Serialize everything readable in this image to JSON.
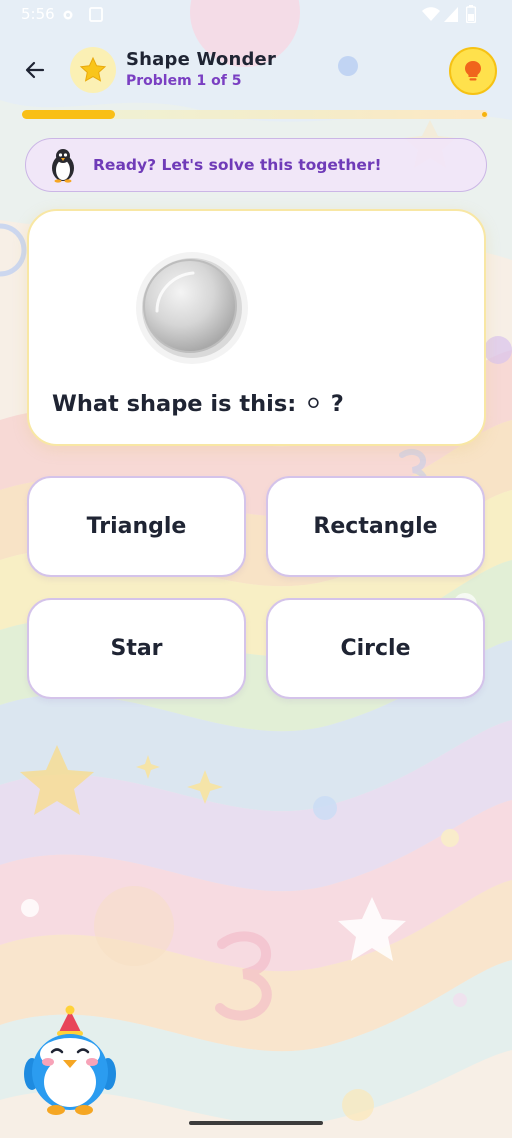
{
  "status_bar": {
    "time": "5:56",
    "icons": [
      "settings-gear-icon",
      "clipboard-icon",
      "wifi-icon",
      "signal-icon",
      "battery-icon"
    ]
  },
  "header": {
    "back_icon": "arrow-left-icon",
    "badge_icon": "star-icon",
    "title": "Shape Wonder",
    "subtitle": "Problem 1 of 5",
    "hint_icon": "lightbulb-icon"
  },
  "progress": {
    "current": 1,
    "total": 5,
    "fraction": 0.2
  },
  "message": {
    "icon": "penguin-icon",
    "text": "Ready? Let's solve this together!"
  },
  "question": {
    "image_icon": "gray-circle-icon",
    "text": "What shape is this: ⚪ ?"
  },
  "answers": [
    {
      "label": "Triangle"
    },
    {
      "label": "Rectangle"
    },
    {
      "label": "Star"
    },
    {
      "label": "Circle"
    }
  ],
  "mascot": {
    "icon": "party-penguin-icon"
  },
  "colors": {
    "accent": "#7a3fc2",
    "progress": "#f9bf16",
    "hint": "#ffe14c",
    "card_border": "#f8e7a4",
    "answer_border": "#d4c3ea"
  }
}
